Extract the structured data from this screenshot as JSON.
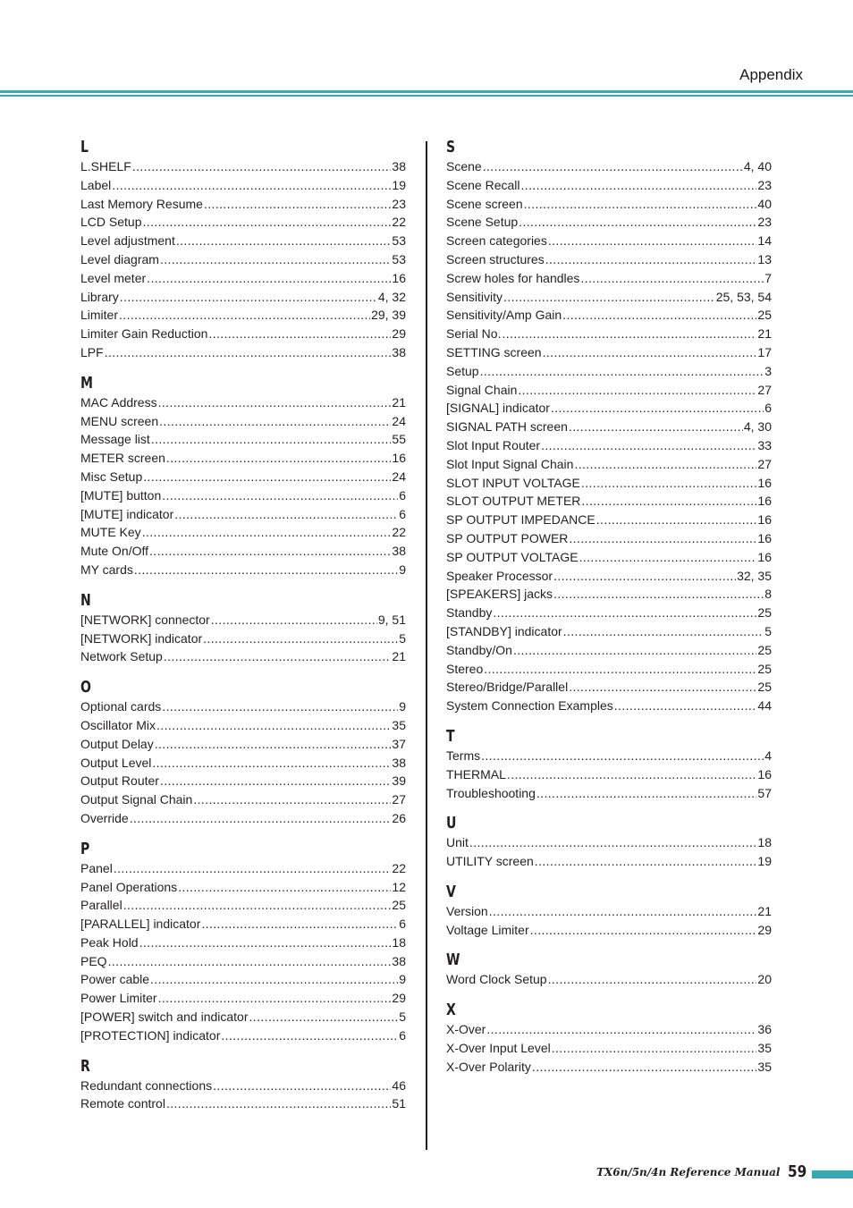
{
  "header": {
    "title": "Appendix",
    "accent_color": "#3aa8b0"
  },
  "index": {
    "left": [
      {
        "letter": "L",
        "entries": [
          {
            "term": "L.SHELF",
            "pages": "38"
          },
          {
            "term": "Label",
            "pages": "19"
          },
          {
            "term": "Last Memory Resume",
            "pages": "23"
          },
          {
            "term": "LCD Setup",
            "pages": "22"
          },
          {
            "term": "Level adjustment",
            "pages": "53"
          },
          {
            "term": "Level diagram",
            "pages": "53"
          },
          {
            "term": "Level meter",
            "pages": "16"
          },
          {
            "term": "Library",
            "pages": "4, 32"
          },
          {
            "term": "Limiter",
            "pages": "29, 39"
          },
          {
            "term": "Limiter Gain Reduction",
            "pages": "29"
          },
          {
            "term": "LPF",
            "pages": "38"
          }
        ]
      },
      {
        "letter": "M",
        "entries": [
          {
            "term": "MAC Address",
            "pages": "21"
          },
          {
            "term": "MENU screen",
            "pages": "24"
          },
          {
            "term": "Message list",
            "pages": "55"
          },
          {
            "term": "METER screen",
            "pages": "16"
          },
          {
            "term": "Misc Setup",
            "pages": "24"
          },
          {
            "term": "[MUTE] button",
            "pages": "6"
          },
          {
            "term": "[MUTE] indicator",
            "pages": "6"
          },
          {
            "term": "MUTE Key",
            "pages": "22"
          },
          {
            "term": "Mute On/Off",
            "pages": "38"
          },
          {
            "term": "MY cards",
            "pages": "9"
          }
        ]
      },
      {
        "letter": "N",
        "entries": [
          {
            "term": "[NETWORK] connector",
            "pages": "9, 51"
          },
          {
            "term": "[NETWORK] indicator",
            "pages": "5"
          },
          {
            "term": "Network Setup",
            "pages": "21"
          }
        ]
      },
      {
        "letter": "O",
        "entries": [
          {
            "term": "Optional cards",
            "pages": "9"
          },
          {
            "term": "Oscillator Mix",
            "pages": "35"
          },
          {
            "term": "Output Delay",
            "pages": "37"
          },
          {
            "term": "Output Level",
            "pages": "38"
          },
          {
            "term": "Output Router",
            "pages": "39"
          },
          {
            "term": "Output Signal Chain",
            "pages": "27"
          },
          {
            "term": "Override",
            "pages": "26"
          }
        ]
      },
      {
        "letter": "P",
        "entries": [
          {
            "term": "Panel",
            "pages": "22"
          },
          {
            "term": "Panel Operations",
            "pages": "12"
          },
          {
            "term": "Parallel",
            "pages": "25"
          },
          {
            "term": "[PARALLEL] indicator",
            "pages": "6"
          },
          {
            "term": "Peak Hold",
            "pages": "18"
          },
          {
            "term": "PEQ",
            "pages": "38"
          },
          {
            "term": "Power cable",
            "pages": "9"
          },
          {
            "term": "Power Limiter",
            "pages": "29"
          },
          {
            "term": "[POWER] switch and indicator",
            "pages": "5"
          },
          {
            "term": "[PROTECTION] indicator",
            "pages": "6"
          }
        ]
      },
      {
        "letter": "R",
        "entries": [
          {
            "term": "Redundant connections",
            "pages": "46"
          },
          {
            "term": "Remote control",
            "pages": "51"
          }
        ]
      }
    ],
    "right": [
      {
        "letter": "S",
        "entries": [
          {
            "term": "Scene",
            "pages": "4, 40"
          },
          {
            "term": "Scene Recall",
            "pages": "23"
          },
          {
            "term": "Scene screen",
            "pages": "40"
          },
          {
            "term": "Scene Setup",
            "pages": "23"
          },
          {
            "term": "Screen categories",
            "pages": "14"
          },
          {
            "term": "Screen structures",
            "pages": "13"
          },
          {
            "term": "Screw holes for handles",
            "pages": "7"
          },
          {
            "term": "Sensitivity",
            "pages": "25, 53, 54"
          },
          {
            "term": "Sensitivity/Amp Gain",
            "pages": "25"
          },
          {
            "term": "Serial No.",
            "pages": "21"
          },
          {
            "term": "SETTING screen",
            "pages": "17"
          },
          {
            "term": "Setup",
            "pages": "3"
          },
          {
            "term": "Signal Chain",
            "pages": "27"
          },
          {
            "term": "[SIGNAL] indicator",
            "pages": "6"
          },
          {
            "term": "SIGNAL PATH screen",
            "pages": "4, 30"
          },
          {
            "term": "Slot Input Router",
            "pages": "33"
          },
          {
            "term": "Slot Input Signal Chain",
            "pages": "27"
          },
          {
            "term": "SLOT INPUT VOLTAGE",
            "pages": "16"
          },
          {
            "term": "SLOT OUTPUT METER",
            "pages": "16"
          },
          {
            "term": "SP OUTPUT IMPEDANCE",
            "pages": "16"
          },
          {
            "term": "SP OUTPUT POWER",
            "pages": "16"
          },
          {
            "term": "SP OUTPUT VOLTAGE",
            "pages": "16"
          },
          {
            "term": "Speaker Processor",
            "pages": "32, 35"
          },
          {
            "term": "[SPEAKERS] jacks",
            "pages": "8"
          },
          {
            "term": "Standby",
            "pages": "25"
          },
          {
            "term": "[STANDBY] indicator",
            "pages": "5"
          },
          {
            "term": "Standby/On",
            "pages": "25"
          },
          {
            "term": "Stereo",
            "pages": "25"
          },
          {
            "term": "Stereo/Bridge/Parallel",
            "pages": "25"
          },
          {
            "term": "System Connection Examples",
            "pages": "44"
          }
        ]
      },
      {
        "letter": "T",
        "entries": [
          {
            "term": "Terms",
            "pages": "4"
          },
          {
            "term": "THERMAL",
            "pages": "16"
          },
          {
            "term": "Troubleshooting",
            "pages": "57"
          }
        ]
      },
      {
        "letter": "U",
        "entries": [
          {
            "term": "Unit",
            "pages": "18"
          },
          {
            "term": "UTILITY screen",
            "pages": "19"
          }
        ]
      },
      {
        "letter": "V",
        "entries": [
          {
            "term": "Version",
            "pages": "21"
          },
          {
            "term": "Voltage Limiter",
            "pages": "29"
          }
        ]
      },
      {
        "letter": "W",
        "entries": [
          {
            "term": "Word Clock Setup",
            "pages": "20"
          }
        ]
      },
      {
        "letter": "X",
        "entries": [
          {
            "term": "X-Over",
            "pages": "36"
          },
          {
            "term": "X-Over Input Level",
            "pages": "35"
          },
          {
            "term": "X-Over Polarity",
            "pages": "35"
          }
        ]
      }
    ]
  },
  "footer": {
    "manual_title": "TX6n/5n/4n  Reference Manual",
    "page_number": "59"
  }
}
